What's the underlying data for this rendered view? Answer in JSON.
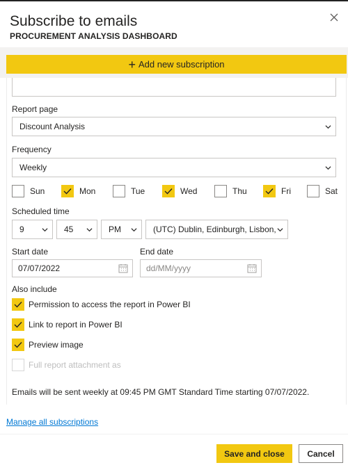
{
  "dialog": {
    "title": "Subscribe to emails",
    "subtitle": "PROCUREMENT ANALYSIS DASHBOARD",
    "close_icon": "close-icon"
  },
  "toolbar": {
    "add_label": "Add new subscription"
  },
  "form": {
    "report_page": {
      "label": "Report page",
      "value": "Discount Analysis"
    },
    "frequency": {
      "label": "Frequency",
      "value": "Weekly"
    },
    "days": [
      {
        "label": "Sun",
        "checked": false
      },
      {
        "label": "Mon",
        "checked": true
      },
      {
        "label": "Tue",
        "checked": false
      },
      {
        "label": "Wed",
        "checked": true
      },
      {
        "label": "Thu",
        "checked": false
      },
      {
        "label": "Fri",
        "checked": true
      },
      {
        "label": "Sat",
        "checked": false
      }
    ],
    "scheduled_time": {
      "label": "Scheduled time",
      "hour": "9",
      "minute": "45",
      "ampm": "PM",
      "timezone": "(UTC) Dublin, Edinburgh, Lisbon, L"
    },
    "start_date": {
      "label": "Start date",
      "value": "07/07/2022"
    },
    "end_date": {
      "label": "End date",
      "placeholder": "dd/MM/yyyy"
    },
    "also_include": {
      "label": "Also include",
      "options": [
        {
          "label": "Permission to access the report in Power BI",
          "checked": true,
          "disabled": false
        },
        {
          "label": "Link to report in Power BI",
          "checked": true,
          "disabled": false
        },
        {
          "label": "Preview image",
          "checked": true,
          "disabled": false
        },
        {
          "label": "Full report attachment as",
          "checked": false,
          "disabled": true
        }
      ]
    },
    "summary": "Emails will be sent weekly at 09:45 PM GMT Standard Time starting 07/07/2022."
  },
  "links": {
    "manage": "Manage all subscriptions"
  },
  "footer": {
    "save_label": "Save and close",
    "cancel_label": "Cancel"
  },
  "colors": {
    "accent": "#f2c811",
    "link": "#0078d4",
    "border": "#c8c6c4"
  }
}
